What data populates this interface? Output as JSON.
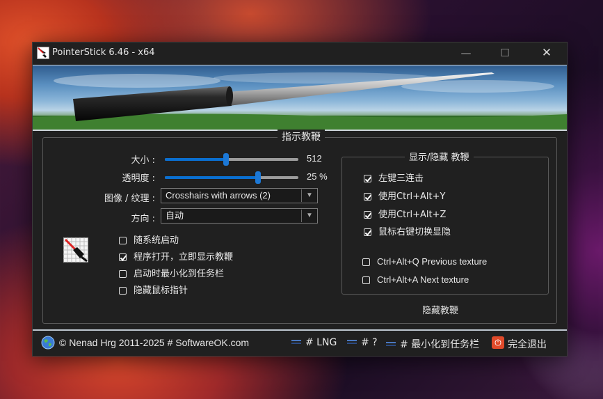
{
  "window": {
    "title": "PointerStick 6.46 - x64",
    "controls": {
      "minimize": "—",
      "maximize": "☐",
      "close": "✕"
    }
  },
  "main_group": {
    "title": "指示教鞭",
    "size": {
      "label": "大小 :",
      "value": "512",
      "level_percent": 46
    },
    "opacity": {
      "label": "透明度 :",
      "value": "25 %",
      "level_percent": 70
    },
    "texture": {
      "label": "图像 / 纹理 :",
      "selected": "Crosshairs with arrows (2)"
    },
    "direction": {
      "label": "方向 :",
      "selected": "自动"
    },
    "options": [
      {
        "label": "随系统启动",
        "checked": false
      },
      {
        "label": "程序打开，立即显示教鞭",
        "checked": true
      },
      {
        "label": "启动时最小化到任务栏",
        "checked": false
      },
      {
        "label": "隐藏鼠标指针",
        "checked": false
      }
    ]
  },
  "show_hide_group": {
    "title": "显示/隐藏 教鞭",
    "options": [
      {
        "label": "左键三连击",
        "checked": true
      },
      {
        "label": "使用Ctrl+Alt+Y",
        "checked": true
      },
      {
        "label": "使用Ctrl+Alt+Z",
        "checked": true
      },
      {
        "label": "鼠标右键切换显隐",
        "checked": true
      },
      {
        "label": "Ctrl+Alt+Q Previous texture",
        "checked": false
      },
      {
        "label": "Ctrl+Alt+A Next texture",
        "checked": false
      }
    ]
  },
  "hide_button": "隐藏教鞭",
  "footer": {
    "copyright": "© Nenad Hrg 2011-2025 # SoftwareOK.com",
    "links": [
      "# LNG",
      "# ?",
      "# 最小化到任务栏"
    ],
    "exit_label": "完全退出"
  },
  "colors": {
    "window_bg": "#202020",
    "accent": "#0a6fd0",
    "border": "#5a5a5a",
    "exit_red": "#e04a2a"
  },
  "icons": [
    "app-icon",
    "minimize-icon",
    "maximize-icon",
    "close-icon",
    "crosshair-texture-icon",
    "globe-icon",
    "exit-icon"
  ]
}
